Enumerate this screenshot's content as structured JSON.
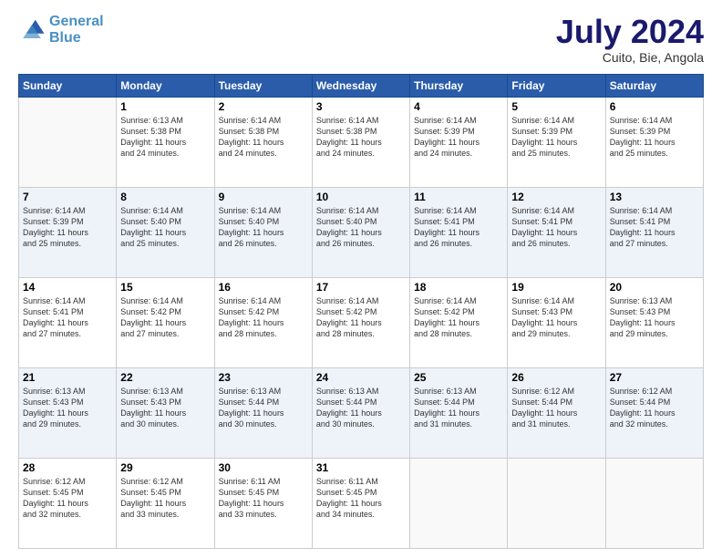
{
  "logo": {
    "line1": "General",
    "line2": "Blue"
  },
  "title": "July 2024",
  "subtitle": "Cuito, Bie, Angola",
  "header_days": [
    "Sunday",
    "Monday",
    "Tuesday",
    "Wednesday",
    "Thursday",
    "Friday",
    "Saturday"
  ],
  "weeks": [
    [
      {
        "num": "",
        "info": ""
      },
      {
        "num": "1",
        "info": "Sunrise: 6:13 AM\nSunset: 5:38 PM\nDaylight: 11 hours\nand 24 minutes."
      },
      {
        "num": "2",
        "info": "Sunrise: 6:14 AM\nSunset: 5:38 PM\nDaylight: 11 hours\nand 24 minutes."
      },
      {
        "num": "3",
        "info": "Sunrise: 6:14 AM\nSunset: 5:38 PM\nDaylight: 11 hours\nand 24 minutes."
      },
      {
        "num": "4",
        "info": "Sunrise: 6:14 AM\nSunset: 5:39 PM\nDaylight: 11 hours\nand 24 minutes."
      },
      {
        "num": "5",
        "info": "Sunrise: 6:14 AM\nSunset: 5:39 PM\nDaylight: 11 hours\nand 25 minutes."
      },
      {
        "num": "6",
        "info": "Sunrise: 6:14 AM\nSunset: 5:39 PM\nDaylight: 11 hours\nand 25 minutes."
      }
    ],
    [
      {
        "num": "7",
        "info": "Sunrise: 6:14 AM\nSunset: 5:39 PM\nDaylight: 11 hours\nand 25 minutes."
      },
      {
        "num": "8",
        "info": "Sunrise: 6:14 AM\nSunset: 5:40 PM\nDaylight: 11 hours\nand 25 minutes."
      },
      {
        "num": "9",
        "info": "Sunrise: 6:14 AM\nSunset: 5:40 PM\nDaylight: 11 hours\nand 26 minutes."
      },
      {
        "num": "10",
        "info": "Sunrise: 6:14 AM\nSunset: 5:40 PM\nDaylight: 11 hours\nand 26 minutes."
      },
      {
        "num": "11",
        "info": "Sunrise: 6:14 AM\nSunset: 5:41 PM\nDaylight: 11 hours\nand 26 minutes."
      },
      {
        "num": "12",
        "info": "Sunrise: 6:14 AM\nSunset: 5:41 PM\nDaylight: 11 hours\nand 26 minutes."
      },
      {
        "num": "13",
        "info": "Sunrise: 6:14 AM\nSunset: 5:41 PM\nDaylight: 11 hours\nand 27 minutes."
      }
    ],
    [
      {
        "num": "14",
        "info": "Sunrise: 6:14 AM\nSunset: 5:41 PM\nDaylight: 11 hours\nand 27 minutes."
      },
      {
        "num": "15",
        "info": "Sunrise: 6:14 AM\nSunset: 5:42 PM\nDaylight: 11 hours\nand 27 minutes."
      },
      {
        "num": "16",
        "info": "Sunrise: 6:14 AM\nSunset: 5:42 PM\nDaylight: 11 hours\nand 28 minutes."
      },
      {
        "num": "17",
        "info": "Sunrise: 6:14 AM\nSunset: 5:42 PM\nDaylight: 11 hours\nand 28 minutes."
      },
      {
        "num": "18",
        "info": "Sunrise: 6:14 AM\nSunset: 5:42 PM\nDaylight: 11 hours\nand 28 minutes."
      },
      {
        "num": "19",
        "info": "Sunrise: 6:14 AM\nSunset: 5:43 PM\nDaylight: 11 hours\nand 29 minutes."
      },
      {
        "num": "20",
        "info": "Sunrise: 6:13 AM\nSunset: 5:43 PM\nDaylight: 11 hours\nand 29 minutes."
      }
    ],
    [
      {
        "num": "21",
        "info": "Sunrise: 6:13 AM\nSunset: 5:43 PM\nDaylight: 11 hours\nand 29 minutes."
      },
      {
        "num": "22",
        "info": "Sunrise: 6:13 AM\nSunset: 5:43 PM\nDaylight: 11 hours\nand 30 minutes."
      },
      {
        "num": "23",
        "info": "Sunrise: 6:13 AM\nSunset: 5:44 PM\nDaylight: 11 hours\nand 30 minutes."
      },
      {
        "num": "24",
        "info": "Sunrise: 6:13 AM\nSunset: 5:44 PM\nDaylight: 11 hours\nand 30 minutes."
      },
      {
        "num": "25",
        "info": "Sunrise: 6:13 AM\nSunset: 5:44 PM\nDaylight: 11 hours\nand 31 minutes."
      },
      {
        "num": "26",
        "info": "Sunrise: 6:12 AM\nSunset: 5:44 PM\nDaylight: 11 hours\nand 31 minutes."
      },
      {
        "num": "27",
        "info": "Sunrise: 6:12 AM\nSunset: 5:44 PM\nDaylight: 11 hours\nand 32 minutes."
      }
    ],
    [
      {
        "num": "28",
        "info": "Sunrise: 6:12 AM\nSunset: 5:45 PM\nDaylight: 11 hours\nand 32 minutes."
      },
      {
        "num": "29",
        "info": "Sunrise: 6:12 AM\nSunset: 5:45 PM\nDaylight: 11 hours\nand 33 minutes."
      },
      {
        "num": "30",
        "info": "Sunrise: 6:11 AM\nSunset: 5:45 PM\nDaylight: 11 hours\nand 33 minutes."
      },
      {
        "num": "31",
        "info": "Sunrise: 6:11 AM\nSunset: 5:45 PM\nDaylight: 11 hours\nand 34 minutes."
      },
      {
        "num": "",
        "info": ""
      },
      {
        "num": "",
        "info": ""
      },
      {
        "num": "",
        "info": ""
      }
    ]
  ]
}
